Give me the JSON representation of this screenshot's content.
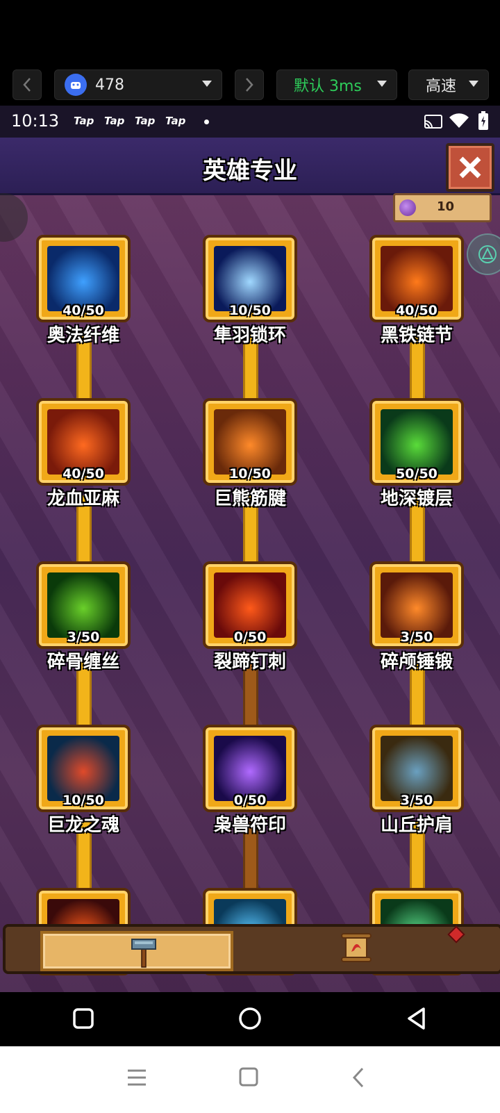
{
  "toolbar": {
    "device_id": "478",
    "latency_label": "默认 3ms",
    "speed_label": "高速"
  },
  "status_bar": {
    "time": "10:13",
    "notifications": [
      "Tap",
      "Tap",
      "Tap",
      "Tap"
    ]
  },
  "game": {
    "title": "英雄专业",
    "currency_value": "10",
    "skills": [
      {
        "name": "奥法纤维",
        "level": "40/50",
        "icon": "arcane-fiber-icon",
        "colors": [
          "#0a2a6a",
          "#3fa0ff"
        ]
      },
      {
        "name": "隼羽锁环",
        "level": "10/50",
        "icon": "falcon-feather-icon",
        "colors": [
          "#0a1a5a",
          "#a0d8ff"
        ]
      },
      {
        "name": "黑铁链节",
        "level": "40/50",
        "icon": "iron-chain-icon",
        "colors": [
          "#6a1a0a",
          "#ff7a1a"
        ]
      },
      {
        "name": "龙血亚麻",
        "level": "40/50",
        "icon": "dragon-blood-icon",
        "colors": [
          "#7a1a0a",
          "#ff6a20"
        ]
      },
      {
        "name": "巨熊筋腱",
        "level": "10/50",
        "icon": "bear-paw-icon",
        "colors": [
          "#6a2a0a",
          "#ff8a2a"
        ]
      },
      {
        "name": "地深镀层",
        "level": "50/50",
        "icon": "earth-plating-icon",
        "colors": [
          "#0a3a1a",
          "#5adc3a"
        ]
      },
      {
        "name": "碎骨缠丝",
        "level": "3/50",
        "icon": "bone-thread-icon",
        "colors": [
          "#0a3a0a",
          "#6ad02a"
        ]
      },
      {
        "name": "裂蹄钉刺",
        "level": "0/50",
        "icon": "hoof-spike-icon",
        "colors": [
          "#6a0a0a",
          "#ff5a1a"
        ]
      },
      {
        "name": "碎颅锤锻",
        "level": "3/50",
        "icon": "skull-hammer-icon",
        "colors": [
          "#5a1a0a",
          "#ff8a2a"
        ]
      },
      {
        "name": "巨龙之魂",
        "level": "10/50",
        "icon": "dragon-soul-icon",
        "colors": [
          "#0a2a4a",
          "#e04a2a"
        ]
      },
      {
        "name": "枭兽符印",
        "level": "0/50",
        "icon": "locked-icon",
        "colors": [
          "#1a0a4a",
          "#b06aff"
        ]
      },
      {
        "name": "山丘护肩",
        "level": "3/50",
        "icon": "mountain-pauldron-icon",
        "colors": [
          "#3a2a10",
          "#6aa0c0"
        ]
      },
      {
        "name": "",
        "level": "",
        "icon": "anvil-fire-icon",
        "colors": [
          "#3a0a0a",
          "#ff5a1a"
        ]
      },
      {
        "name": "",
        "level": "",
        "icon": "locked-icon",
        "colors": [
          "#0a3a5a",
          "#5ac8ff"
        ]
      },
      {
        "name": "",
        "level": "",
        "icon": "metal-ingot-icon",
        "colors": [
          "#0a3a1a",
          "#5adc8a"
        ]
      }
    ]
  }
}
